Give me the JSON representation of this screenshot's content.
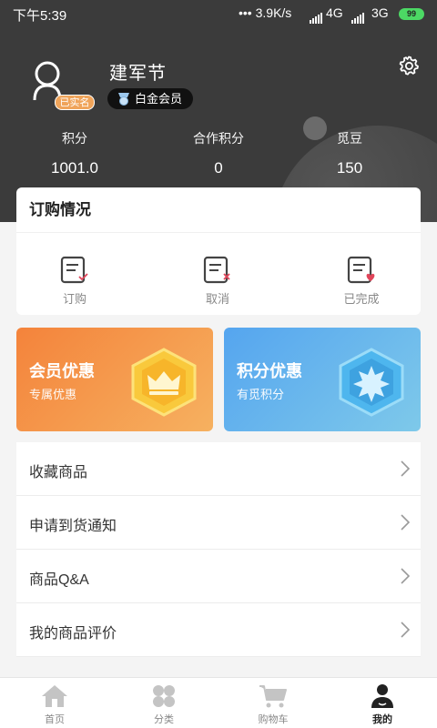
{
  "status_bar": {
    "time": "下午5:39",
    "network_speed": "3.9K/s",
    "network_1": "4G",
    "network_2": "3G",
    "battery": "99"
  },
  "profile": {
    "username": "建军节",
    "verified_label": "已实名",
    "member_level": "白金会员"
  },
  "stats": [
    {
      "label": "积分",
      "value": "1001.0"
    },
    {
      "label": "合作积分",
      "value": "0"
    },
    {
      "label": "觅豆",
      "value": "150"
    }
  ],
  "orders": {
    "title": "订购情况",
    "items": [
      {
        "label": "订购",
        "icon": "order-check-icon"
      },
      {
        "label": "取消",
        "icon": "order-cancel-icon"
      },
      {
        "label": "已完成",
        "icon": "order-done-icon"
      }
    ]
  },
  "promos": [
    {
      "title": "会员优惠",
      "subtitle": "专属优惠",
      "icon": "crown-icon",
      "color": "#f4833b"
    },
    {
      "title": "积分优惠",
      "subtitle": "有觅积分",
      "icon": "star-badge-icon",
      "color": "#55a5ef"
    }
  ],
  "menu": [
    {
      "label": "收藏商品"
    },
    {
      "label": "申请到货通知"
    },
    {
      "label": "商品Q&A"
    },
    {
      "label": "我的商品评价"
    }
  ],
  "bottom_nav": [
    {
      "label": "首页",
      "icon": "home-icon"
    },
    {
      "label": "分类",
      "icon": "category-icon"
    },
    {
      "label": "购物车",
      "icon": "cart-icon"
    },
    {
      "label": "我的",
      "icon": "user-icon",
      "active": true
    }
  ]
}
